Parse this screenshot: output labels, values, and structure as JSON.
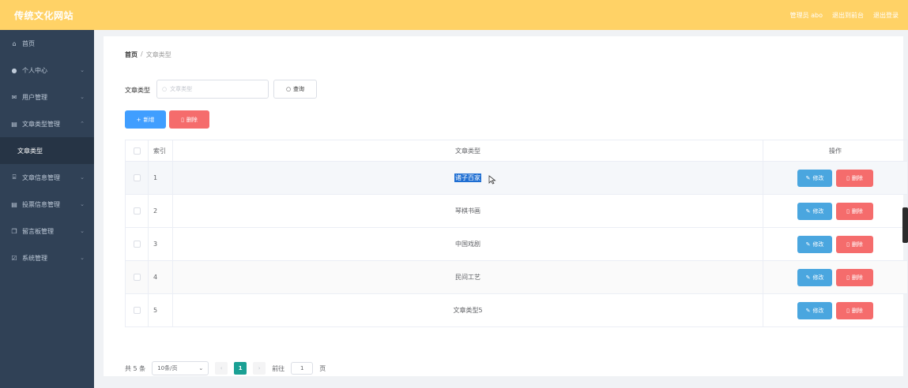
{
  "header": {
    "title": "传统文化网站",
    "user_label": "管理员 abo",
    "exit_home": "退出到前台",
    "logout": "退出登录"
  },
  "sidebar": {
    "items": [
      {
        "label": "首页",
        "icon": "home-icon"
      },
      {
        "label": "个人中心",
        "icon": "user-icon"
      },
      {
        "label": "用户管理",
        "icon": "mail-icon"
      },
      {
        "label": "文章类型管理",
        "icon": "doc-icon"
      },
      {
        "label": "文章类型",
        "icon": ""
      },
      {
        "label": "文章信息管理",
        "icon": "bank-icon"
      },
      {
        "label": "投票信息管理",
        "icon": "doc-icon"
      },
      {
        "label": "留言板管理",
        "icon": "copy-icon"
      },
      {
        "label": "系统管理",
        "icon": "check-icon"
      }
    ]
  },
  "breadcrumb": {
    "home": "首页",
    "sep": "/",
    "current": "文章类型"
  },
  "search": {
    "label": "文章类型",
    "placeholder": "文章类型",
    "query_label": "查询"
  },
  "actions": {
    "add_label": "新增",
    "delete_label": "删除"
  },
  "table": {
    "headers": {
      "index": "索引",
      "type": "文章类型",
      "ops": "操作"
    },
    "rows": [
      {
        "index": "1",
        "type": "诸子百家"
      },
      {
        "index": "2",
        "type": "琴棋书画"
      },
      {
        "index": "3",
        "type": "中国戏剧"
      },
      {
        "index": "4",
        "type": "民间工艺"
      },
      {
        "index": "5",
        "type": "文章类型5"
      }
    ],
    "edit_label": "修改",
    "delete_label": "删除"
  },
  "pagination": {
    "total": "共 5 条",
    "page_size": "10条/页",
    "current_page": "1",
    "goto_label": "前往",
    "goto_value": "1",
    "page_unit": "页"
  }
}
